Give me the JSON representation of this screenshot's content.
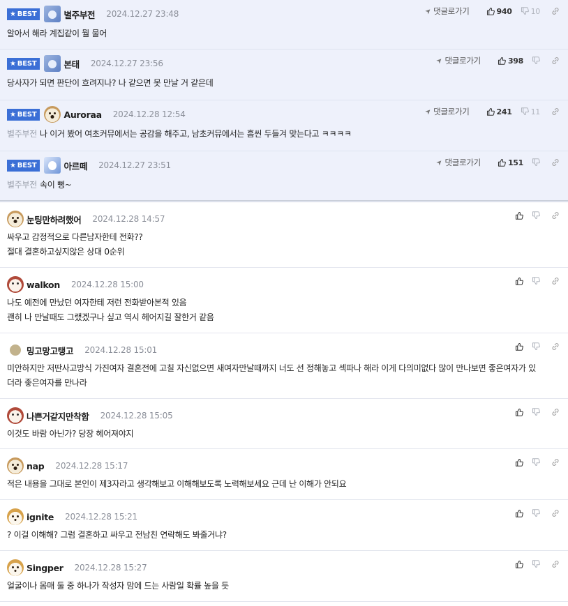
{
  "labels": {
    "best": "BEST",
    "reply": "댓글로가기"
  },
  "colors": {
    "best_bg": "#eef1fb",
    "badge": "#3b6fd6",
    "date": "#8b8f99"
  },
  "best_comments": [
    {
      "author": "별주부전",
      "date": "2024.12.27 23:48",
      "avatar": "koala-icon",
      "reply_to": "",
      "lines": [
        "알아서 해라 계집같이 뭘 물어"
      ],
      "likes": "940",
      "dislikes": "10"
    },
    {
      "author": "본태",
      "date": "2024.12.27 23:56",
      "avatar": "koala-icon",
      "reply_to": "",
      "lines": [
        "당사자가 되면 판단이 흐려지나? 나 같으면 못 만날 거 같은데"
      ],
      "likes": "398",
      "dislikes": ""
    },
    {
      "author": "Auroraa",
      "date": "2024.12.28 12:54",
      "avatar": "dog-icon",
      "reply_to": "별주부전",
      "lines": [
        "나 이거 봤어 여초커뮤에서는 공감을 해주고, 남초커뮤에서는 흠씬 두들겨 맞는다고 ㅋㅋㅋㅋ"
      ],
      "likes": "241",
      "dislikes": "11"
    },
    {
      "author": "아르떼",
      "date": "2024.12.27 23:51",
      "avatar": "blue-icon",
      "reply_to": "별주부전",
      "lines": [
        "속이 뻥~"
      ],
      "likes": "151",
      "dislikes": ""
    }
  ],
  "comments": [
    {
      "author": "눈팅만하려했어",
      "date": "2024.12.28 14:57",
      "avatar": "dog-icon",
      "lines": [
        "싸우고 감정적으로 다른남자한테 전화??",
        "절대 결혼하고싶지않은 상대 0순위"
      ]
    },
    {
      "author": "walkon",
      "date": "2024.12.28 15:00",
      "avatar": "bear-icon",
      "lines": [
        "나도 예전에 만났던 여자한테 저런 전화받아본적 있음",
        "괜히 나 만날때도 그랬겠구나 싶고 역시 헤어지길 잘한거 같음"
      ]
    },
    {
      "author": "밍고망고탱고",
      "date": "2024.12.28 15:01",
      "avatar": "bean-icon",
      "lines": [
        "미안하지만 저딴사고방식 가진여자 결혼전에 고칠 자신없으면 새여자만날때까지 너도 선 정해놓고 섹파나 해라 이게 다의미없다 많이 만나보면 좋은여자가 있",
        "더라 좋은여자를 만나라"
      ]
    },
    {
      "author": "나쁜거같지만착함",
      "date": "2024.12.28 15:05",
      "avatar": "bear-icon",
      "lines": [
        "이것도 바람 아닌가? 당장 헤어져야지"
      ]
    },
    {
      "author": "nap",
      "date": "2024.12.28 15:17",
      "avatar": "dog-icon",
      "lines": [
        "적은 내용을 그대로 본인이 제3자라고 생각해보고 이해해보도록 노력해보세요 근데 난 이해가 안되요"
      ]
    },
    {
      "author": "ignite",
      "date": "2024.12.28 15:21",
      "avatar": "fox-icon",
      "lines": [
        "? 이걸 이해해? 그럼 결혼하고 싸우고 전남친 연락해도 봐줄거냐?"
      ]
    },
    {
      "author": "Singper",
      "date": "2024.12.28 15:27",
      "avatar": "fox-icon",
      "lines": [
        "얼굴이나 몸매 둘 중 하나가 작성자 맘에 드는 사람일 확률 높을 듯"
      ]
    }
  ]
}
